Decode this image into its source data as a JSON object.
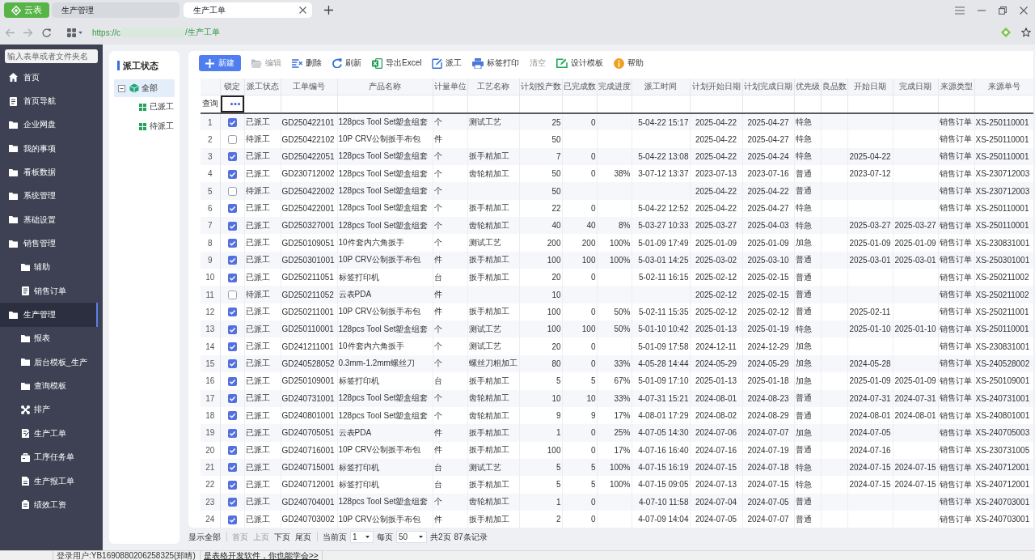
{
  "browser": {
    "app_button": {
      "label": "云表"
    },
    "tabs": [
      {
        "label": "生产管理",
        "selected": false,
        "closable": false
      },
      {
        "label": "生产工单",
        "selected": true,
        "closable": true
      }
    ],
    "address": {
      "url_start": "https://c",
      "url_end": "/生产工单"
    }
  },
  "sidebar": {
    "search": {
      "placeholder": "输入表单或者文件夹名"
    },
    "items": [
      {
        "label": "首页",
        "kind": "home",
        "selected": false
      },
      {
        "label": "首页导航",
        "kind": "page",
        "selected": false
      },
      {
        "label": "企业网盘",
        "kind": "folder",
        "selected": false
      },
      {
        "label": "我的事项",
        "kind": "folder",
        "selected": false
      },
      {
        "label": "看板数据",
        "kind": "folder",
        "selected": false
      },
      {
        "label": "系统管理",
        "kind": "folder",
        "selected": false
      },
      {
        "label": "基础设置",
        "kind": "folder",
        "selected": false
      },
      {
        "label": "销售管理",
        "kind": "folder",
        "selected": false,
        "children": [
          {
            "label": "辅助",
            "kind": "folder",
            "selected": false
          },
          {
            "label": "销售订单",
            "kind": "page",
            "selected": false
          }
        ]
      },
      {
        "label": "生产管理",
        "kind": "folder",
        "selected": true,
        "children": [
          {
            "label": "报表",
            "kind": "folder",
            "selected": false
          },
          {
            "label": "后台模板_生产",
            "kind": "folder",
            "selected": false
          },
          {
            "label": "查询模板",
            "kind": "folder",
            "selected": false
          },
          {
            "label": "排产",
            "kind": "tools",
            "selected": false
          },
          {
            "label": "生产工单",
            "kind": "form",
            "selected": false
          },
          {
            "label": "工序任务单",
            "kind": "case",
            "selected": false
          },
          {
            "label": "生产报工单",
            "kind": "report",
            "selected": false
          },
          {
            "label": "绩效工资",
            "kind": "clipboard",
            "selected": false
          }
        ]
      }
    ]
  },
  "status_tree": {
    "title": "派工状态",
    "nodes": [
      {
        "label": "全部",
        "kind": "all",
        "selected": true,
        "expanded": true,
        "children": [
          {
            "label": "已派工",
            "kind": "status",
            "selected": false
          },
          {
            "label": "待派工",
            "kind": "status",
            "selected": false
          }
        ]
      }
    ]
  },
  "toolbar": [
    {
      "label": "新建",
      "kind": "new",
      "primary": true,
      "disabled": false
    },
    {
      "label": "编辑",
      "kind": "edit",
      "primary": false,
      "disabled": true
    },
    {
      "label": "删除",
      "kind": "delete",
      "primary": false,
      "disabled": false
    },
    {
      "label": "刷新",
      "kind": "refresh",
      "primary": false,
      "disabled": false
    },
    {
      "label": "导出Excel",
      "kind": "excel",
      "primary": false,
      "disabled": false
    },
    {
      "label": "派工",
      "kind": "dispatch",
      "primary": false,
      "disabled": false
    },
    {
      "label": "标签打印",
      "kind": "print",
      "primary": false,
      "disabled": false
    },
    {
      "label": "清空",
      "kind": "clear",
      "primary": false,
      "disabled": true
    },
    {
      "label": "设计模板",
      "kind": "template",
      "primary": false,
      "disabled": false
    },
    {
      "label": "帮助",
      "kind": "help",
      "primary": false,
      "disabled": false
    }
  ],
  "table": {
    "columns": [
      "锁定",
      "派工状态",
      "工单编号",
      "产品名称",
      "计量单位",
      "工艺名称",
      "计划投产数",
      "已完成数",
      "完成进度",
      "派工时间",
      "计划开始日期",
      "计划完成日期",
      "优先级",
      "良品数",
      "开始日期",
      "完成日期",
      "来源类型",
      "来源单号"
    ],
    "query": {
      "label": "查询",
      "cells": [
        {
          "focused": true
        },
        {
          "focused": false
        },
        {
          "focused": false
        },
        {
          "focused": false
        },
        {
          "focused": false
        },
        {
          "focused": false
        },
        {
          "focused": false
        },
        {
          "focused": false
        },
        {
          "focused": false
        },
        {
          "focused": false
        },
        {
          "focused": false
        },
        {
          "focused": false
        },
        {
          "focused": false
        },
        {
          "focused": false
        },
        {
          "focused": false
        },
        {
          "focused": false
        },
        {
          "focused": false
        },
        {
          "focused": false
        }
      ]
    },
    "rows": [
      {
        "no": "1",
        "locked": true,
        "dispatch_status": "已派工",
        "order_no": "GD250422101",
        "product": "128pcs Tool Set塑盒组套",
        "unit": "个",
        "process": "测试工艺",
        "planned_qty": "25",
        "done_qty": "0",
        "dispatch_time": "5-04-22 15:17",
        "plan_start": "2025-04-22",
        "plan_end": "2025-04-27",
        "priority": "特急",
        "source_type": "销售订单",
        "source_no": "XS-250110001"
      },
      {
        "no": "2",
        "locked": false,
        "dispatch_status": "待派工",
        "order_no": "GD250422102",
        "product": "10P CRV公制扳手布包",
        "unit": "件",
        "planned_qty": "50",
        "plan_start": "2025-04-22",
        "plan_end": "2025-04-27",
        "priority": "特急",
        "source_type": "销售订单",
        "source_no": "XS-250110001"
      },
      {
        "no": "3",
        "locked": true,
        "dispatch_status": "已派工",
        "order_no": "GD250422051",
        "product": "128pcs Tool Set塑盒组套",
        "unit": "个",
        "process": "扳手精加工",
        "planned_qty": "7",
        "done_qty": "0",
        "dispatch_time": "5-04-22 13:08",
        "plan_start": "2025-04-22",
        "plan_end": "2025-04-24",
        "priority": "特急",
        "start_date": "2025-04-22",
        "source_type": "销售订单",
        "source_no": "XS-250110001"
      },
      {
        "no": "4",
        "locked": true,
        "dispatch_status": "已派工",
        "order_no": "GD230712002",
        "product": "128pcs Tool Set塑盒组套",
        "unit": "个",
        "process": "齿轮精加工",
        "planned_qty": "50",
        "done_qty": "0",
        "progress": "38%",
        "dispatch_time": "3-07-12 13:37",
        "plan_start": "2023-07-13",
        "plan_end": "2023-07-16",
        "priority": "普通",
        "start_date": "2023-07-12",
        "source_type": "销售订单",
        "source_no": "XS-230712003"
      },
      {
        "no": "5",
        "locked": false,
        "dispatch_status": "待派工",
        "order_no": "GD250422002",
        "product": "128pcs Tool Set塑盒组套",
        "unit": "个",
        "planned_qty": "50",
        "plan_start": "2025-04-22",
        "plan_end": "2025-04-22",
        "priority": "普通",
        "source_type": "销售订单",
        "source_no": "XS-230712003"
      },
      {
        "no": "6",
        "locked": true,
        "dispatch_status": "已派工",
        "order_no": "GD250422001",
        "product": "128pcs Tool Set塑盒组套",
        "unit": "个",
        "process": "扳手精加工",
        "planned_qty": "22",
        "done_qty": "0",
        "dispatch_time": "5-04-22 12:52",
        "plan_start": "2025-04-22",
        "plan_end": "2025-04-27",
        "priority": "特急",
        "source_type": "销售订单",
        "source_no": "XS-250110001"
      },
      {
        "no": "7",
        "locked": true,
        "dispatch_status": "已派工",
        "order_no": "GD250327001",
        "product": "128pcs Tool Set塑盒组套",
        "unit": "个",
        "process": "齿轮精加工",
        "planned_qty": "40",
        "done_qty": "40",
        "progress": "8%",
        "dispatch_time": "5-03-27 10:33",
        "plan_start": "2025-03-27",
        "plan_end": "2025-04-03",
        "priority": "特急",
        "start_date": "2025-03-27",
        "finish_date": "2025-03-27",
        "source_type": "销售订单",
        "source_no": "XS-250110001"
      },
      {
        "no": "8",
        "locked": true,
        "dispatch_status": "已派工",
        "order_no": "GD250109051",
        "product": "10件套内六角扳手",
        "unit": "个",
        "process": "测试工艺",
        "planned_qty": "200",
        "done_qty": "200",
        "progress": "100%",
        "dispatch_time": "5-01-09 17:49",
        "plan_start": "2025-01-09",
        "plan_end": "2025-01-09",
        "priority": "加急",
        "start_date": "2025-01-09",
        "finish_date": "2025-01-09",
        "source_type": "销售订单",
        "source_no": "XS-230831001"
      },
      {
        "no": "9",
        "locked": true,
        "dispatch_status": "已派工",
        "order_no": "GD250301001",
        "product": "10P CRV公制扳手布包",
        "unit": "件",
        "process": "扳手精加工",
        "planned_qty": "100",
        "done_qty": "100",
        "progress": "100%",
        "dispatch_time": "5-03-01 14:25",
        "plan_start": "2025-03-02",
        "plan_end": "2025-03-10",
        "priority": "普通",
        "start_date": "2025-03-01",
        "finish_date": "2025-03-01",
        "source_type": "销售订单",
        "source_no": "XS-250301001"
      },
      {
        "no": "10",
        "locked": true,
        "dispatch_status": "已派工",
        "order_no": "GD250211051",
        "product": "标签打印机",
        "unit": "台",
        "process": "扳手精加工",
        "planned_qty": "20",
        "done_qty": "0",
        "dispatch_time": "5-02-11 16:15",
        "plan_start": "2025-02-12",
        "plan_end": "2025-02-15",
        "priority": "普通",
        "source_type": "销售订单",
        "source_no": "XS-250211002"
      },
      {
        "no": "11",
        "locked": false,
        "dispatch_status": "待派工",
        "order_no": "GD250211052",
        "product": "云表PDA",
        "unit": "件",
        "planned_qty": "10",
        "plan_start": "2025-02-12",
        "plan_end": "2025-02-15",
        "priority": "普通",
        "source_type": "销售订单",
        "source_no": "XS-250211002"
      },
      {
        "no": "12",
        "locked": true,
        "dispatch_status": "已派工",
        "order_no": "GD250211001",
        "product": "10P CRV公制扳手布包",
        "unit": "件",
        "process": "扳手精加工",
        "planned_qty": "100",
        "done_qty": "0",
        "progress": "50%",
        "dispatch_time": "5-02-11 15:35",
        "plan_start": "2025-02-12",
        "plan_end": "2025-02-12",
        "priority": "普通",
        "start_date": "2025-02-11",
        "source_type": "销售订单",
        "source_no": "XS-250211001"
      },
      {
        "no": "13",
        "locked": true,
        "dispatch_status": "已派工",
        "order_no": "GD250110001",
        "product": "128pcs Tool Set塑盒组套",
        "unit": "个",
        "process": "测试工艺",
        "planned_qty": "100",
        "done_qty": "100",
        "progress": "50%",
        "dispatch_time": "5-01-10 10:42",
        "plan_start": "2025-01-13",
        "plan_end": "2025-01-19",
        "priority": "特急",
        "start_date": "2025-01-10",
        "finish_date": "2025-01-10",
        "source_type": "销售订单",
        "source_no": "XS-250110001"
      },
      {
        "no": "14",
        "locked": true,
        "dispatch_status": "已派工",
        "order_no": "GD241211001",
        "product": "10件套内六角扳手",
        "unit": "个",
        "process": "测试工艺",
        "planned_qty": "20",
        "done_qty": "0",
        "dispatch_time": "5-01-09 17:58",
        "plan_start": "2024-12-11",
        "plan_end": "2024-12-29",
        "priority": "加急",
        "source_type": "销售订单",
        "source_no": "XS-230831001"
      },
      {
        "no": "15",
        "locked": true,
        "dispatch_status": "已派工",
        "order_no": "GD240528052",
        "product": "0.3mm-1.2mm螺丝刀",
        "unit": "个",
        "process": "螺丝刀粗加工",
        "planned_qty": "80",
        "done_qty": "0",
        "progress": "33%",
        "dispatch_time": "4-05-28 14:44",
        "plan_start": "2024-05-29",
        "plan_end": "2024-05-29",
        "priority": "加急",
        "start_date": "2024-05-28",
        "source_type": "销售订单",
        "source_no": "XS-240528002"
      },
      {
        "no": "16",
        "locked": true,
        "dispatch_status": "已派工",
        "order_no": "GD250109001",
        "product": "标签打印机",
        "unit": "台",
        "process": "扳手精加工",
        "planned_qty": "5",
        "done_qty": "5",
        "progress": "67%",
        "dispatch_time": "5-01-09 17:10",
        "plan_start": "2025-01-13",
        "plan_end": "2025-01-18",
        "priority": "加急",
        "start_date": "2025-01-09",
        "finish_date": "2025-01-09",
        "source_type": "销售订单",
        "source_no": "XS-250109001"
      },
      {
        "no": "17",
        "locked": true,
        "dispatch_status": "已派工",
        "order_no": "GD240731001",
        "product": "128pcs Tool Set塑盒组套",
        "unit": "个",
        "process": "齿轮精加工",
        "planned_qty": "10",
        "done_qty": "10",
        "progress": "33%",
        "dispatch_time": "4-07-31 15:21",
        "plan_start": "2024-08-01",
        "plan_end": "2024-08-23",
        "priority": "普通",
        "start_date": "2024-07-31",
        "finish_date": "2024-07-31",
        "source_type": "销售订单",
        "source_no": "XS-240731001"
      },
      {
        "no": "18",
        "locked": true,
        "dispatch_status": "已派工",
        "order_no": "GD240801001",
        "product": "128pcs Tool Set塑盒组套",
        "unit": "个",
        "process": "齿轮精加工",
        "planned_qty": "9",
        "done_qty": "9",
        "progress": "17%",
        "dispatch_time": "4-08-01 17:29",
        "plan_start": "2024-08-02",
        "plan_end": "2024-08-29",
        "priority": "普通",
        "start_date": "2024-08-01",
        "finish_date": "2024-08-01",
        "source_type": "销售订单",
        "source_no": "XS-240801001"
      },
      {
        "no": "19",
        "locked": true,
        "dispatch_status": "已派工",
        "order_no": "GD240705051",
        "product": "云表PDA",
        "unit": "件",
        "process": "扳手精加工",
        "planned_qty": "1",
        "done_qty": "0",
        "progress": "25%",
        "dispatch_time": "4-07-05 14:30",
        "plan_start": "2024-07-06",
        "plan_end": "2024-07-07",
        "priority": "加急",
        "start_date": "2024-07-05",
        "source_type": "销售订单",
        "source_no": "XS-240705003"
      },
      {
        "no": "20",
        "locked": true,
        "dispatch_status": "已派工",
        "order_no": "GD240716001",
        "product": "10P CRV公制扳手布包",
        "unit": "件",
        "process": "扳手精加工",
        "planned_qty": "100",
        "done_qty": "0",
        "progress": "17%",
        "dispatch_time": "4-07-16 16:40",
        "plan_start": "2024-07-16",
        "plan_end": "2024-07-19",
        "priority": "普通",
        "start_date": "2024-07-16",
        "source_type": "销售订单",
        "source_no": "XS-230731005"
      },
      {
        "no": "21",
        "locked": true,
        "dispatch_status": "已派工",
        "order_no": "GD240715001",
        "product": "标签打印机",
        "unit": "台",
        "process": "测试工艺",
        "planned_qty": "5",
        "done_qty": "5",
        "progress": "100%",
        "dispatch_time": "4-07-15 16:19",
        "plan_start": "2024-07-15",
        "plan_end": "2024-07-18",
        "priority": "特急",
        "start_date": "2024-07-15",
        "finish_date": "2024-07-15",
        "source_type": "销售订单",
        "source_no": "XS-240712001"
      },
      {
        "no": "22",
        "locked": true,
        "dispatch_status": "已派工",
        "order_no": "GD240712001",
        "product": "标签打印机",
        "unit": "台",
        "process": "扳手精加工",
        "planned_qty": "5",
        "done_qty": "5",
        "progress": "100%",
        "dispatch_time": "4-07-15 09:05",
        "plan_start": "2024-07-13",
        "plan_end": "2024-07-15",
        "priority": "特急",
        "start_date": "2024-07-15",
        "finish_date": "2024-07-15",
        "source_type": "销售订单",
        "source_no": "XS-240712001"
      },
      {
        "no": "23",
        "locked": true,
        "dispatch_status": "已派工",
        "order_no": "GD240704001",
        "product": "128pcs Tool Set塑盒组套",
        "unit": "个",
        "process": "齿轮精加工",
        "planned_qty": "1",
        "done_qty": "0",
        "dispatch_time": "4-07-10 11:58",
        "plan_start": "2024-07-04",
        "plan_end": "2024-07-05",
        "priority": "普通",
        "source_type": "销售订单",
        "source_no": "XS-240703001"
      },
      {
        "no": "24",
        "locked": true,
        "dispatch_status": "已派工",
        "order_no": "GD240703002",
        "product": "10P CRV公制扳手布包",
        "unit": "件",
        "process": "扳手精加工",
        "planned_qty": "2",
        "done_qty": "0",
        "dispatch_time": "4-07-09 14:04",
        "plan_start": "2024-07-05",
        "plan_end": "2024-07-07",
        "priority": "普通",
        "source_type": "销售订单",
        "source_no": "XS-240703001"
      }
    ]
  },
  "pagination": {
    "show_all": "显示全部",
    "links": [
      {
        "label": "首页",
        "disabled": true
      },
      {
        "label": "上页",
        "disabled": true
      },
      {
        "label": "下页",
        "disabled": false
      },
      {
        "label": "尾页",
        "disabled": false
      }
    ],
    "current_label": "当前页",
    "current_page": "1",
    "per_page_label": "每页",
    "per_page": "50",
    "total_pages": "共2页",
    "total_records": "87条记录"
  },
  "status_bar": {
    "user": "登录用户:YB1690880206258325(郑晴)",
    "link": "是表格开发软件，你也能学会>>"
  }
}
